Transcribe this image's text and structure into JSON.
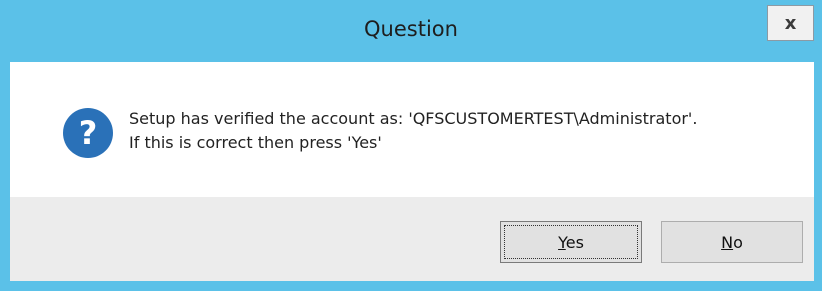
{
  "window": {
    "title": "Question",
    "close_label": "x"
  },
  "message": {
    "line1": "Setup has verified the account as: 'QFSCUSTOMERTEST\\Administrator'.",
    "line2": "If this is correct then press 'Yes'"
  },
  "icon": {
    "name": "question-icon",
    "glyph": "?",
    "color": "#2a71b8"
  },
  "buttons": {
    "yes": {
      "label": "Yes",
      "mnemonic": "Y",
      "rest": "es"
    },
    "no": {
      "label": "No",
      "mnemonic": "N",
      "rest": "o"
    }
  },
  "colors": {
    "titlebar": "#5bc1e8",
    "content_bg": "#ffffff",
    "footer_bg": "#ececec"
  }
}
